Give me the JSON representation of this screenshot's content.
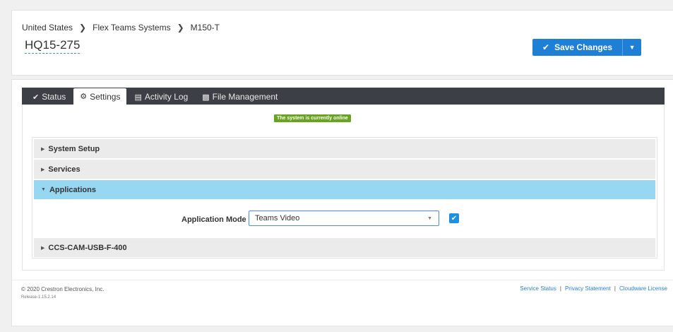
{
  "breadcrumb": [
    "United States",
    "Flex Teams Systems",
    "M150-T"
  ],
  "device_name": "HQ15-275",
  "toolbar": {
    "save_label": "Save Changes"
  },
  "tabs": [
    {
      "label": "Status",
      "icon": "check-icon"
    },
    {
      "label": "Settings",
      "icon": "gear-icon"
    },
    {
      "label": "Activity Log",
      "icon": "list-icon"
    },
    {
      "label": "File Management",
      "icon": "file-icon"
    }
  ],
  "active_tab": "Settings",
  "status_badge": "The system is currently online",
  "accordion": [
    {
      "label": "System Setup",
      "expanded": false
    },
    {
      "label": "Services",
      "expanded": false
    },
    {
      "label": "Applications",
      "expanded": true
    },
    {
      "label": "CCS-CAM-USB-F-400",
      "expanded": false
    }
  ],
  "application_mode": {
    "label": "Application Mode",
    "value": "Teams Video",
    "checked": true
  },
  "footer": {
    "copyright": "© 2020 Crestron Electronics, Inc.",
    "release": "Release-1.15.2.14",
    "links": [
      "Service Status",
      "Privacy Statement",
      "Cloudware License"
    ]
  },
  "colors": {
    "accent": "#1e7fd6",
    "tabbar": "#3c3f45",
    "online": "#6aa31f",
    "expanded": "#98d7f2"
  }
}
